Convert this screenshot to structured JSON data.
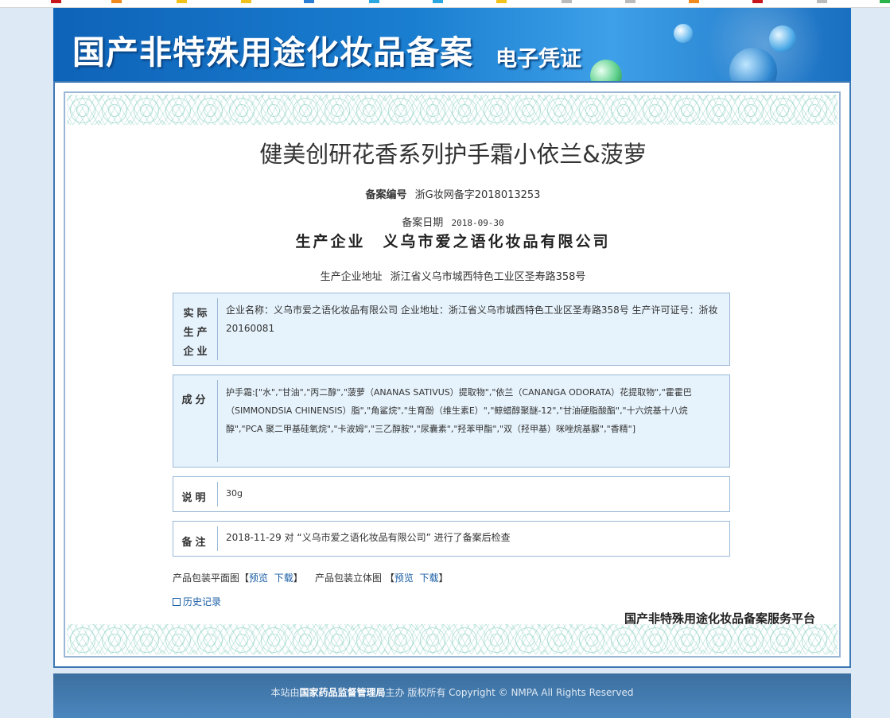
{
  "banner": {
    "title": "国产非特殊用途化妆品备案",
    "subtitle": "电子凭证"
  },
  "product": {
    "name": "健美创研花香系列护手霜小依兰&菠萝",
    "record_no_label": "备案编号",
    "record_no": "浙G妆网备字2018013253",
    "record_date_label": "备案日期",
    "record_date": "2018-09-30",
    "producer_label": "生产企业",
    "producer": "义乌市爱之语化妆品有限公司",
    "producer_addr_label": "生产企业地址",
    "producer_addr": "浙江省义乌市城西特色工业区圣寿路358号"
  },
  "sections": {
    "actual": {
      "label": "实际生产企业",
      "text": "企业名称：义乌市爱之语化妆品有限公司  企业地址：浙江省义乌市城西特色工业区圣寿路358号  生产许可证号：浙妆20160081"
    },
    "ingredients": {
      "label": "成分",
      "text": "护手霜:[\"水\",\"甘油\",\"丙二醇\",\"菠萝（ANANAS SATIVUS）提取物\",\"依兰（CANANGA ODORATA）花提取物\",\"霍霍巴（SIMMONDSIA CHINENSIS）脂\",\"角鲨烷\",\"生育酚（维生素E）\",\"鲸蜡醇聚醚-12\",\"甘油硬脂酸酯\",\"十六烷基十八烷醇\",\"PCA 聚二甲基硅氧烷\",\"卡波姆\",\"三乙醇胺\",\"尿囊素\",\"羟苯甲酯\",\"双（羟甲基）咪唑烷基脲\",\"香精\"]"
    },
    "description": {
      "label": "说明",
      "text": "30g"
    },
    "remarks": {
      "label": "备注",
      "text": "2018-11-29 对 “义乌市爱之语化妆品有限公司” 进行了备案后检查"
    }
  },
  "package": {
    "flat_label": "产品包装平面图",
    "solid_label": "产品包装立体图",
    "preview": "预览",
    "download": "下载",
    "bracket_open": "【",
    "bracket_close": "】"
  },
  "history_label": "历史记录",
  "platform_name": "国产非特殊用途化妆品备案服务平台",
  "footer": {
    "prefix": "本站由",
    "org": "国家药品监督管理局",
    "suffix": "主办 版权所有 Copyright © NMPA All Rights Reserved"
  },
  "colors": {
    "banner": "#1a7ed0",
    "frame_border": "#3e78b4",
    "panel_blue": "#e6f3fc",
    "link": "#1a5ea6",
    "footer": "#4a86bd"
  }
}
